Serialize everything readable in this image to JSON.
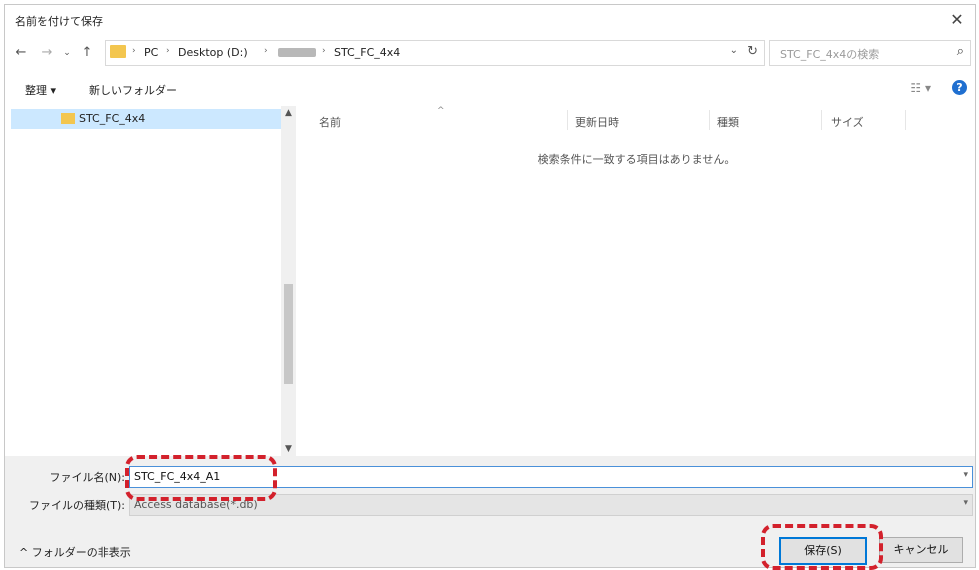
{
  "dialog": {
    "title": "名前を付けて保存",
    "close_glyph": "✕"
  },
  "nav": {
    "back": "←",
    "forward": "→",
    "recent": "⌄",
    "up": "↑"
  },
  "address": {
    "crumbs": [
      "PC",
      "Desktop (D:)",
      "STC_FC_4x4"
    ],
    "separator": "›",
    "dropdown": "⌄",
    "refresh": "↻"
  },
  "search": {
    "placeholder": "STC_FC_4x4の検索",
    "icon": "⌕"
  },
  "toolbar": {
    "organize": "整理 ▾",
    "new_folder": "新しいフォルダー",
    "view": "☷ ▾",
    "help": "?"
  },
  "nav_pane": {
    "items": [
      {
        "label": "STC_FC_4x4",
        "selected": true
      }
    ]
  },
  "file_list": {
    "columns": [
      "名前",
      "更新日時",
      "種類",
      "サイズ"
    ],
    "sort_arrow": "^",
    "empty_message": "検索条件に一致する項目はありません。"
  },
  "form": {
    "filename_label": "ファイル名(N):",
    "filename_value": "STC_FC_4x4_A1",
    "filetype_label": "ファイルの種類(T):",
    "filetype_value": "Access database(*.db)"
  },
  "footer": {
    "hide_folders": "^ フォルダーの非表示",
    "save_button": "保存(S)",
    "cancel_button": "キャンセル"
  },
  "colors": {
    "highlight": "#d3212c",
    "primary_border": "#0078d7",
    "folder": "#f3c64f"
  }
}
